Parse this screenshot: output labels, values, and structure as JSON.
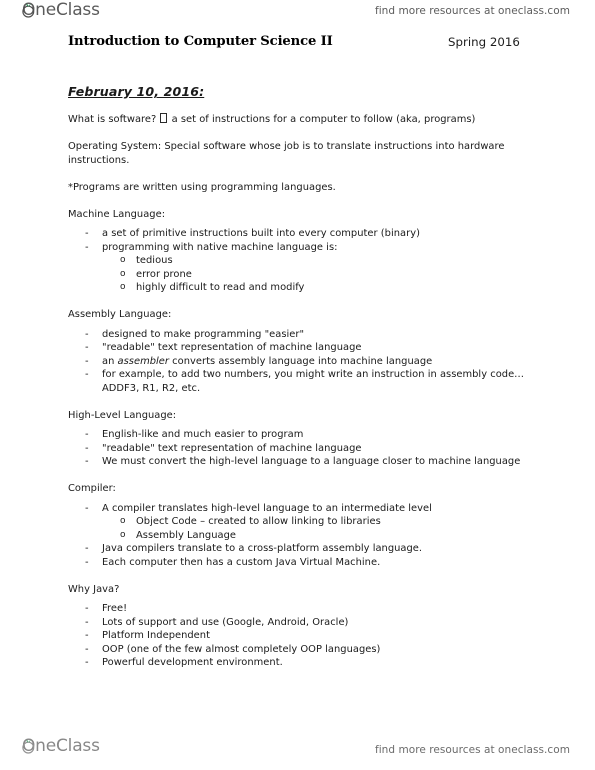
{
  "brand": {
    "name": "OneClass",
    "leaf_color": "#2f8a56",
    "mark_color": "#4f4f4f",
    "text_color": "#5b5b5b"
  },
  "header": {
    "promo": "find more resources at oneclass.com"
  },
  "footer": {
    "promo": "find more resources at oneclass.com"
  },
  "title_row": {
    "course_title": "Introduction to Computer Science II",
    "term": "Spring 2016"
  },
  "document": {
    "date_heading": "February 10, 2016:",
    "intro": {
      "software_q_before": "What is software? ",
      "software_q_after": " a set of instructions for a computer to follow (aka, programs)",
      "operating_system": "Operating System: Special software whose job is to translate instructions into hardware instructions.",
      "programs_note": "*Programs are written using programming languages."
    },
    "sections": [
      {
        "label": "Machine Language:",
        "items": [
          {
            "text": "a set of primitive instructions built into every computer (binary)"
          },
          {
            "text": "programming with native machine language is:",
            "sub": [
              "tedious",
              "error prone",
              "highly difficult to read and modify"
            ]
          }
        ]
      },
      {
        "label": "Assembly Language:",
        "items": [
          {
            "text": "designed to make programming \"easier\""
          },
          {
            "text": "\"readable\" text representation of machine language"
          },
          {
            "rich": true,
            "before": "an ",
            "italic": "assembler",
            "after": " converts assembly language into machine language"
          },
          {
            "text": "for example, to add two numbers, you might write an instruction in assembly code… ADDF3, R1, R2, etc."
          }
        ]
      },
      {
        "label": "High-Level Language:",
        "items": [
          {
            "text": "English-like and much easier to program"
          },
          {
            "text": "\"readable\" text representation of machine language"
          },
          {
            "text": "We must convert the high-level language to a language closer to machine language"
          }
        ]
      },
      {
        "label": "Compiler:",
        "items": [
          {
            "text": "A compiler translates high-level language to an intermediate level",
            "sub": [
              "Object Code – created to allow linking to libraries",
              "Assembly Language"
            ]
          },
          {
            "text": "Java compilers translate to a cross-platform assembly language."
          },
          {
            "text": "Each computer then has a custom Java Virtual Machine."
          }
        ]
      },
      {
        "label": "Why Java?",
        "items": [
          {
            "text": "Free!"
          },
          {
            "text": "Lots of support and use (Google, Android, Oracle)"
          },
          {
            "text": "Platform Independent"
          },
          {
            "text": "OOP (one of the few almost completely OOP languages)"
          },
          {
            "text": "Powerful development environment."
          }
        ]
      }
    ]
  },
  "icons": {
    "dash_bullet": "-",
    "circle_bullet": "o",
    "missing_glyph": "missing-character-box"
  }
}
